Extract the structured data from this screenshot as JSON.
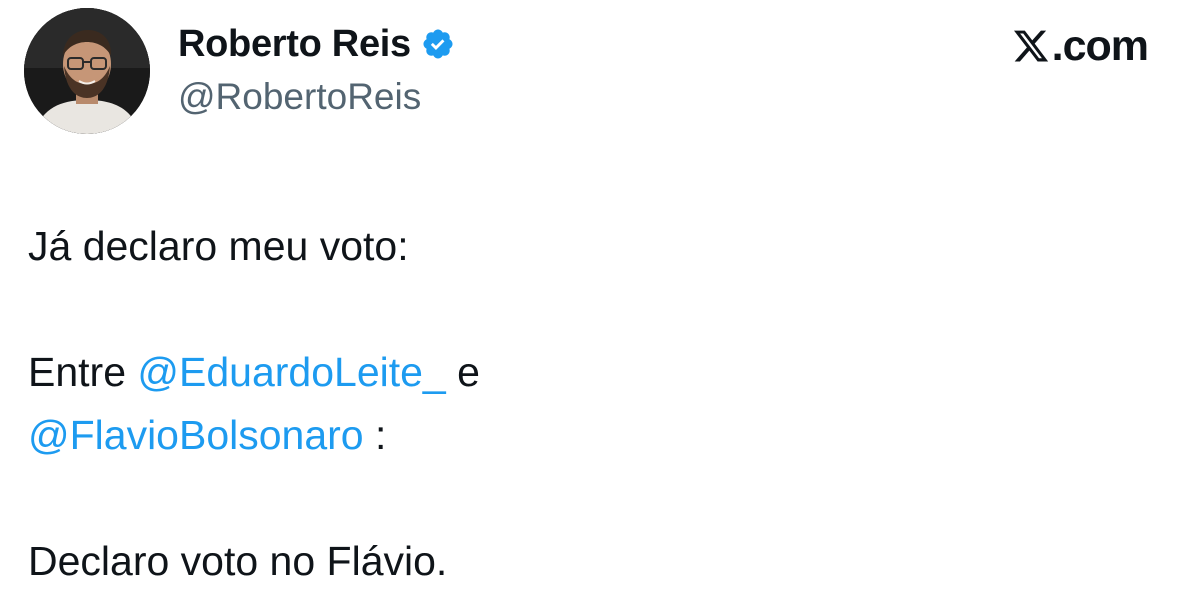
{
  "author": {
    "display_name": "Roberto Reis",
    "handle": "@RobertoReis",
    "verified": true,
    "avatar_icon": "profile-photo-avatar"
  },
  "brand": {
    "text": ".com",
    "logo_icon": "x-logo-icon"
  },
  "tweet": {
    "line1": "Já declaro meu voto:",
    "line2_prefix": "Entre ",
    "mention1": "@EduardoLeite_",
    "line2_suffix": " e",
    "mention2": "@FlavioBolsonaro",
    "line3_suffix": " :",
    "line4": "Declaro voto no Flávio."
  },
  "colors": {
    "text": "#0f1419",
    "secondary_text": "#536471",
    "mention": "#1d9bf0",
    "verified_badge": "#1d9bf0"
  }
}
